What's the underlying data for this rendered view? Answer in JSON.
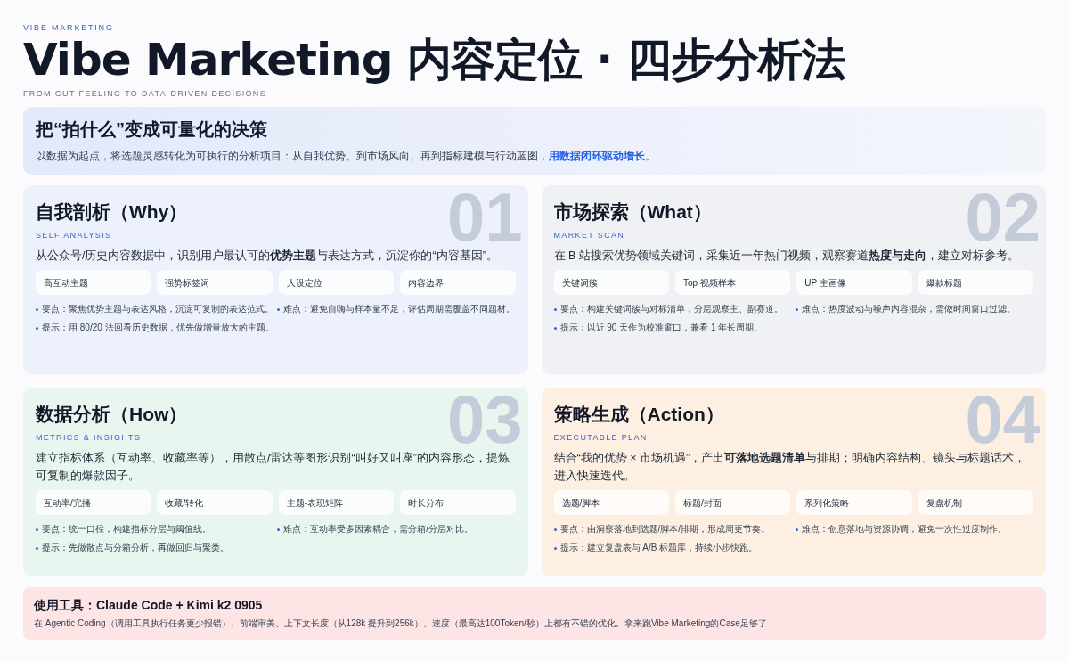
{
  "header": {
    "kicker": "VIBE MARKETING",
    "title": "Vibe Marketing 内容定位 · 四步分析法",
    "subtitle": "FROM GUT FEELING TO DATA-DRIVEN DECISIONS"
  },
  "banner": {
    "title": "把“拍什么”变成可量化的决策",
    "text": "以数据为起点，将选题灵感转化为可执行的分析项目：从自我优势、到市场风向、再到指标建模与行动蓝图，",
    "highlight": "用数据闭环驱动增长",
    "end": "。"
  },
  "cards": [
    {
      "number": "01",
      "title": "自我剖析（Why）",
      "kicker": "SELF ANALYSIS",
      "color": "#ecf1fc",
      "description": "从公众号/历史内容数据中，识别用户最认可的**优势主题**与表达方式，沉淀你的“内容基因”。",
      "chips": [
        "高互动主题",
        "强势标签词",
        "人设定位",
        "内容边界"
      ],
      "left_notes": [
        "要点：聚焦优势主题与表达风格，沉淀可复制的表达范式。",
        "提示：用 80/20 法回看历史数据，优先做增量放大的主题。"
      ],
      "right_notes": [
        "难点：避免自嗨与样本量不足，评估周期需覆盖不同题材。"
      ]
    },
    {
      "number": "02",
      "title": "市场探索（What）",
      "kicker": "MARKET SCAN",
      "color": "#eff1f4",
      "description": "在 B 站搜索优势领域关键词，采集近一年热门视频，观察赛道**热度与走向**，建立对标参考。",
      "chips": [
        "关键词簇",
        "Top 视频样本",
        "UP 主画像",
        "爆款标题"
      ],
      "left_notes": [
        "要点：构建关键词簇与对标清单，分层观察主、副赛道。",
        "提示：以近 90 天作为校准窗口，兼看 1 年长周期。"
      ],
      "right_notes": [
        "难点：热度波动与噪声内容混杂，需做时间窗口过滤。"
      ]
    },
    {
      "number": "03",
      "title": "数据分析（How）",
      "kicker": "METRICS & INSIGHTS",
      "color": "#e9f5ef",
      "description": "建立指标体系（互动率、收藏率等），用散点/雷达等图形识别“叫好又叫座”的内容形态，提炼可复制的爆款因子。",
      "chips": [
        "互动率/完播",
        "收藏/转化",
        "主题-表现矩阵",
        "时长分布"
      ],
      "left_notes": [
        "要点：统一口径，构建指标分层与阈值线。",
        "提示：先做散点与分箱分析，再做回归与聚类。"
      ],
      "right_notes": [
        "难点：互动率受多因素耦合，需分箱/分层对比。"
      ]
    },
    {
      "number": "04",
      "title": "策略生成（Action）",
      "kicker": "EXECUTABLE PLAN",
      "color": "#fdf0e2",
      "description": "结合“我的优势 × 市场机遇”，产出**可落地选题清单**与排期；明确内容结构、镜头与标题话术，进入快速迭代。",
      "chips": [
        "选题/脚本",
        "标题/封面",
        "系列化策略",
        "复盘机制"
      ],
      "left_notes": [
        "要点：由洞察落地到选题/脚本/排期，形成周更节奏。",
        "提示：建立复盘表与 A/B 标题库，持续小步快跑。"
      ],
      "right_notes": [
        "难点：创意落地与资源协调，避免一次性过度制作。"
      ]
    }
  ],
  "tools": {
    "label": "使用工具：",
    "value": "Claude Code + Kimi k2 0905",
    "text": "在 Agentic Coding（调用工具执行任务更少报错）、前端审美、上下文长度（从128k 提升到256k）、速度（最高达100Token/秒）上都有不错的优化。拿来跑Vibe Marketing的Case足够了"
  }
}
